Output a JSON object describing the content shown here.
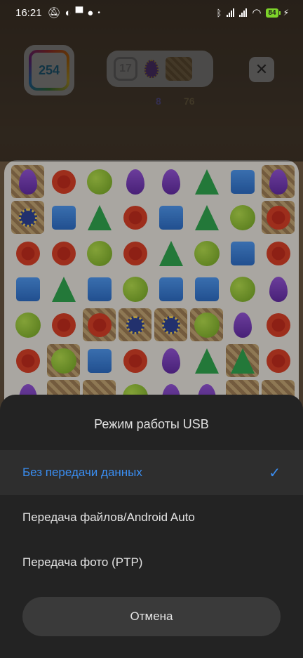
{
  "status_bar": {
    "time": "16:21",
    "battery": "84",
    "icons": [
      "muted-icon",
      "app-icon",
      "usb-icon",
      "record-icon",
      "dot-icon",
      "bluetooth-icon",
      "signal-icon",
      "signal-icon",
      "wifi-icon",
      "charging-icon"
    ]
  },
  "game": {
    "score": "254",
    "moves": "17",
    "goals": [
      {
        "icon": "ornament-egg-icon",
        "count": "8",
        "color": "#7b6fd0"
      },
      {
        "icon": "cookie-block-icon",
        "count": "76",
        "color": "#a18a5c"
      }
    ],
    "board_rows": [
      [
        "purple*",
        "red",
        "green",
        "purple",
        "purple",
        "tree",
        "blue",
        "purple*"
      ],
      [
        "orn*",
        "blue",
        "tree",
        "red",
        "blue",
        "tree",
        "green",
        "red*"
      ],
      [
        "red",
        "red",
        "green",
        "red",
        "tree",
        "green",
        "blue",
        "red"
      ],
      [
        "blue",
        "tree",
        "blue",
        "green",
        "blue",
        "blue",
        "green",
        "purple"
      ],
      [
        "green",
        "red",
        "red*",
        "orn*",
        "orn*",
        "green*",
        "purple",
        "red"
      ],
      [
        "red",
        "green*",
        "blue",
        "red",
        "purple",
        "tree",
        "tree*",
        "red"
      ],
      [
        "purple",
        "cookie*",
        "cookie*",
        "green",
        "purple",
        "purple",
        "cookie*",
        "cookie*"
      ]
    ]
  },
  "usb_dialog": {
    "title": "Режим работы USB",
    "options": [
      {
        "label": "Без передачи данных",
        "selected": true
      },
      {
        "label": "Передача файлов/Android Auto",
        "selected": false
      },
      {
        "label": "Передача фото (PTP)",
        "selected": false
      }
    ],
    "cancel_label": "Отмена",
    "accent_color": "#3a8ef2"
  }
}
